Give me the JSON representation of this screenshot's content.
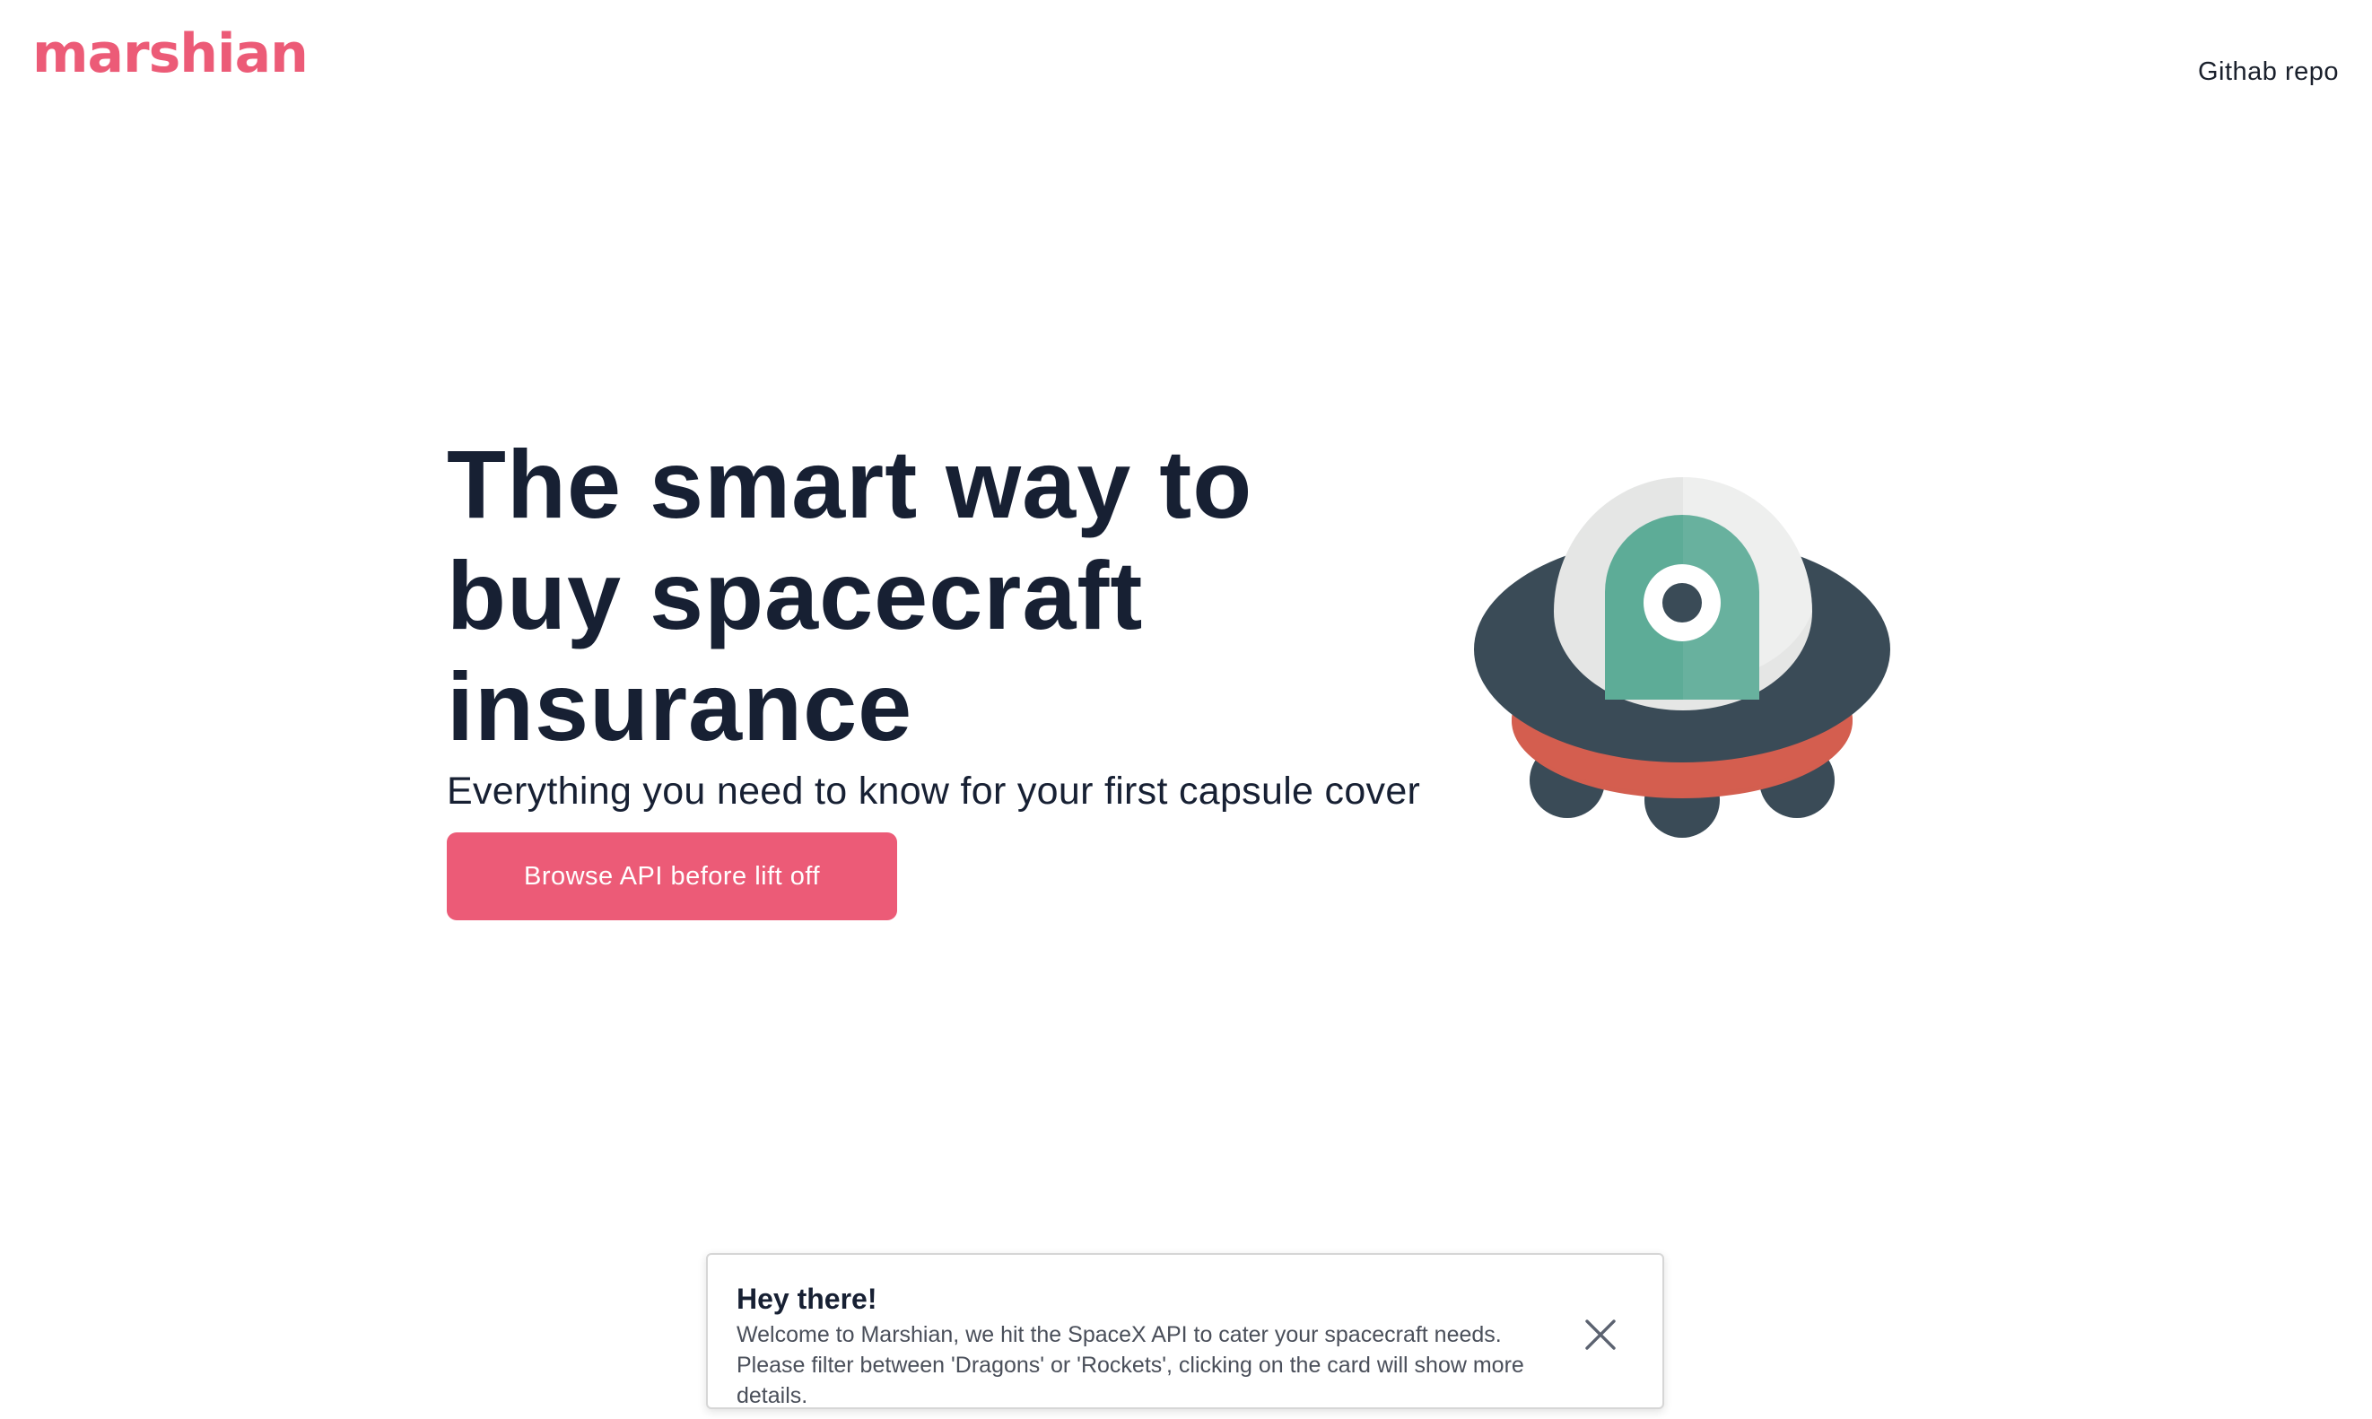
{
  "header": {
    "logo_text": "marshian",
    "nav_link_label": "Githab repo"
  },
  "hero": {
    "title": "The smart way to buy spacecraft insurance",
    "subtitle": "Everything you need to know for your first capsule cover",
    "cta_label": "Browse API before lift off"
  },
  "toast": {
    "title": "Hey there!",
    "message": "Welcome to Marshian, we hit the SpaceX API to cater your spacecraft needs. Please filter between 'Dragons' or 'Rockets', clicking on the card will show more details."
  },
  "icons": {
    "illustration": "ufo-spaceship-icon",
    "close": "close-icon"
  },
  "colors": {
    "brand": "#EC5B77",
    "heading": "#172033",
    "text_muted": "#4a4f5a",
    "ufo_body": "#3A4B57",
    "ufo_ring": "#D35E4F",
    "ufo_dome": "#E5E6E5",
    "ufo_pilot": "#5DAC97"
  }
}
